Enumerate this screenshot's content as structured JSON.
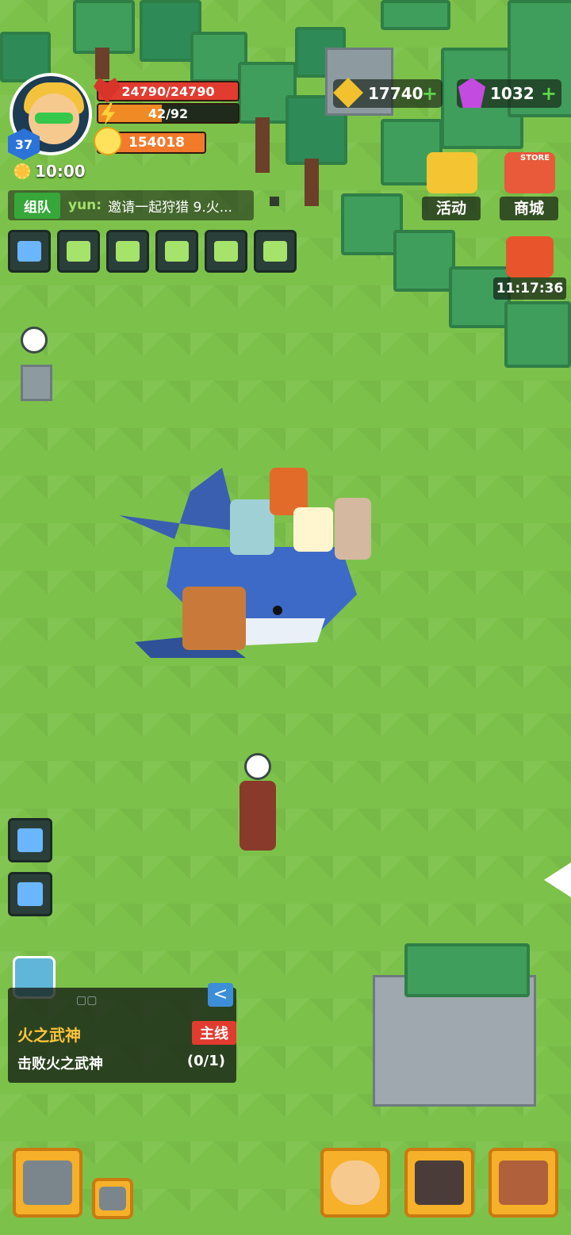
{
  "player": {
    "level": "37",
    "hp_text": "24790/24790",
    "energy_text": "42/92",
    "energy_fraction": 0.457,
    "power": "154018",
    "time": "10:00"
  },
  "currency": {
    "gold": "17740",
    "gems": "1032"
  },
  "shop": {
    "events_label": "活动",
    "store_label": "商城",
    "store_tag": "STORE",
    "gift_timer": "11:17:36"
  },
  "chat": {
    "channel": "组队",
    "sender": "yun:",
    "message": "邀请一起狩猎 9.火..."
  },
  "quest": {
    "dots": "▢▢",
    "collapse": "<",
    "title": "火之武神",
    "tag": "主线",
    "objective": "击败火之武神",
    "progress": "(0/1)"
  },
  "icons": {
    "toolbar": [
      "fullscreen-icon",
      "mail-icon",
      "friends-icon",
      "chat-icon",
      "map-icon",
      "notice-icon"
    ],
    "side": [
      "home-icon",
      "location-icon"
    ],
    "actions": [
      "craft-hammer-icon",
      "build-icon",
      "heroes-icon",
      "pets-icon",
      "backpack-icon"
    ]
  },
  "colors": {
    "hp": "#e23b2f",
    "energy": "#f08a24",
    "power": "#f27a2b",
    "quest_title": "#ffc43b",
    "quest_tag": "#e23b2f",
    "grass": "#7cc24a"
  }
}
